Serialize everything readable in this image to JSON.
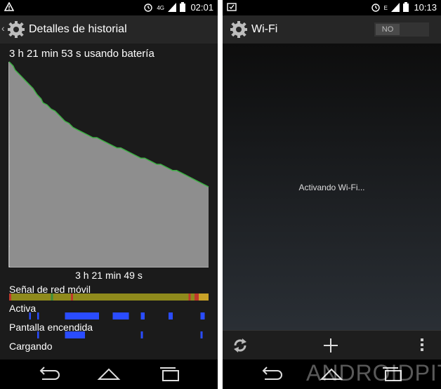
{
  "left_screen": {
    "status": {
      "time": "02:01",
      "network": "4G"
    },
    "title": "Detalles de historial",
    "summary": "3 h 21 min 53 s usando batería",
    "chart_caption": "3 h 21 min 49 s",
    "rows": {
      "signal": "Señal de red móvil",
      "active": "Activa",
      "screen_on": "Pantalla encendida",
      "charging": "Cargando"
    },
    "chart_data": {
      "type": "area",
      "title": "",
      "xlabel": "",
      "ylabel": "",
      "x": [
        0,
        2,
        3,
        4,
        5,
        6,
        8,
        10,
        12,
        14,
        16,
        17,
        19,
        21,
        23,
        25,
        27,
        28,
        30,
        32,
        34,
        36,
        38,
        40,
        42,
        44,
        46,
        48,
        50,
        52,
        54,
        56,
        58,
        60,
        62,
        64,
        66,
        68,
        70,
        72,
        74,
        76,
        78,
        80,
        82,
        84,
        86,
        88,
        90,
        92,
        94,
        96,
        98,
        100
      ],
      "values": [
        100,
        98,
        96,
        95,
        94,
        93,
        91,
        89,
        87,
        84,
        82,
        80,
        79,
        77,
        76,
        74,
        72,
        71,
        70,
        68,
        67,
        66,
        65,
        64,
        63,
        63,
        62,
        61,
        60,
        59,
        58,
        58,
        57,
        56,
        55,
        54,
        53,
        53,
        52,
        51,
        50,
        50,
        49,
        48,
        47,
        47,
        46,
        45,
        44,
        43,
        42,
        41,
        40,
        39
      ],
      "ylim": [
        0,
        100
      ],
      "fill_color": "#8e8e8e",
      "line_color": "#3cb043"
    }
  },
  "right_screen": {
    "status": {
      "time": "10:13",
      "network": "E"
    },
    "title": "Wi-Fi",
    "toggle_label": "NO",
    "message": "Activando Wi-Fi..."
  },
  "watermark": "ANDROIDPIT",
  "colors": {
    "accent_green": "#3cb043",
    "active_blue": "#2a4cff",
    "signal_yellow": "#8f8a1c",
    "signal_red": "#c0392b"
  }
}
